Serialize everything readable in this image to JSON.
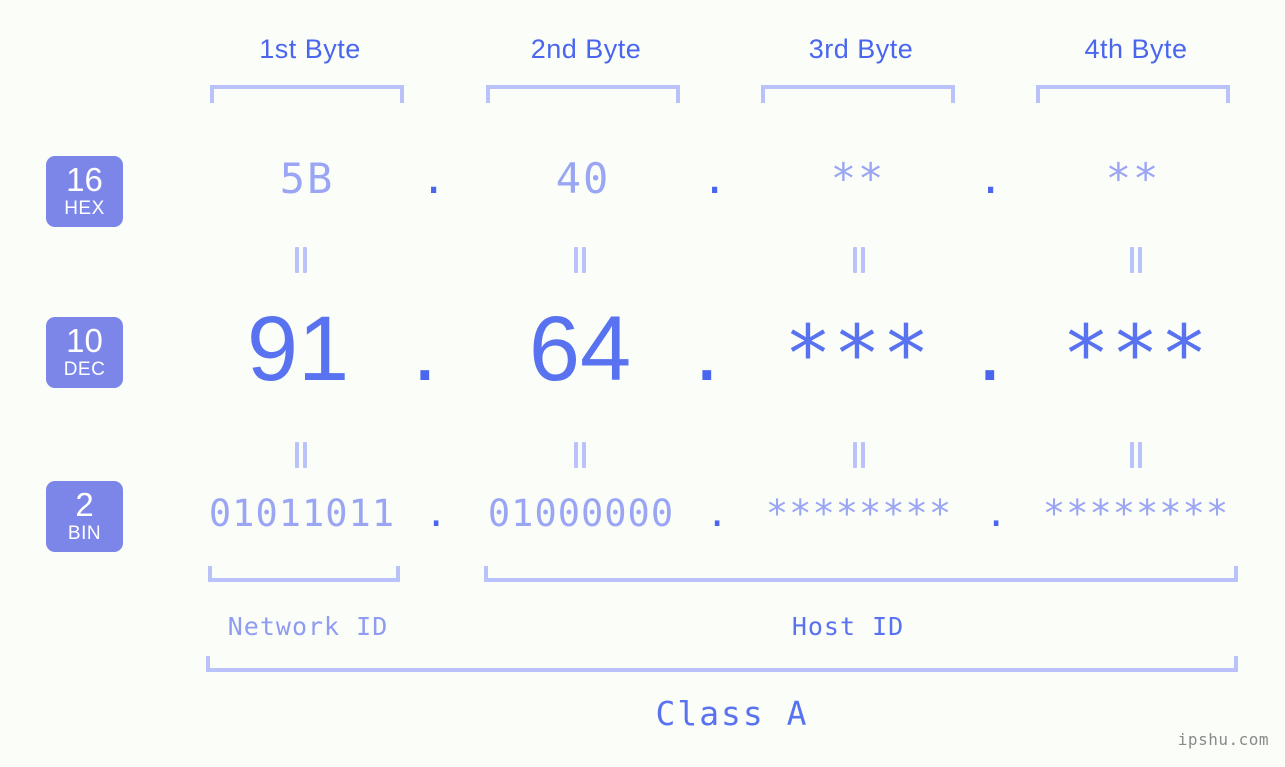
{
  "watermark": "ipshu.com",
  "byte_headers": [
    {
      "label": "1st Byte"
    },
    {
      "label": "2nd Byte"
    },
    {
      "label": "3rd Byte"
    },
    {
      "label": "4th Byte"
    }
  ],
  "bases": [
    {
      "number": "16",
      "name": "HEX"
    },
    {
      "number": "10",
      "name": "DEC"
    },
    {
      "number": "2",
      "name": "BIN"
    }
  ],
  "separator": ".",
  "rows": {
    "hex": {
      "base_number": "16",
      "base_name": "HEX",
      "values": [
        "5B",
        "40",
        "**",
        "**"
      ]
    },
    "dec": {
      "base_number": "10",
      "base_name": "DEC",
      "values": [
        "91",
        "64",
        "***",
        "***"
      ]
    },
    "bin": {
      "base_number": "2",
      "base_name": "BIN",
      "values": [
        "01011011",
        "01000000",
        "********",
        "********"
      ]
    }
  },
  "ip": {
    "hex_address": "5B.40.**.**",
    "dec_address": "91.64.***.***",
    "bin_address": "01011011.01000000.********.********"
  },
  "sections": {
    "network_id": "Network ID",
    "host_id": "Host ID",
    "class": "Class A"
  },
  "colors": {
    "background": "#fbfdf8",
    "badge": "#7b86e8",
    "accent_strong": "#4a66ef",
    "accent_medium": "#5872f0",
    "accent_light": "#9aa6f4",
    "bracket": "#b9c2fb",
    "watermark": "#8a8a8a"
  }
}
